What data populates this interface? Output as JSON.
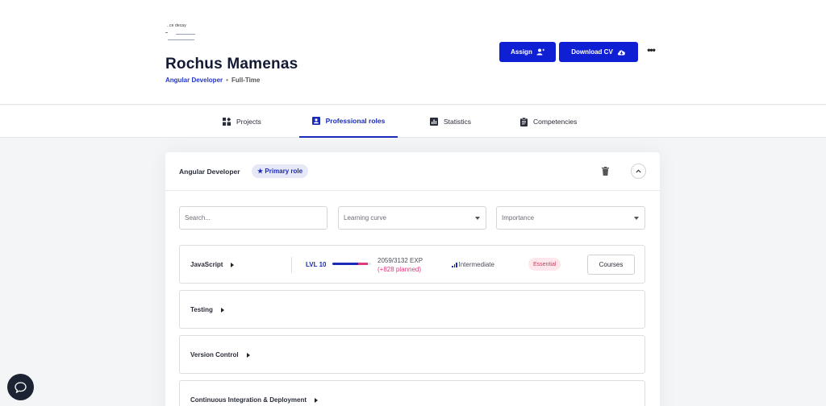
{
  "header": {
    "logo_text": "..ce decay",
    "name": "Rochus Mamenas",
    "role": "Angular Developer",
    "separator": "•",
    "employment": "Full-Time",
    "assign_label": "Assign",
    "download_label": "Download CV",
    "more_label": "•••"
  },
  "tabs": [
    {
      "label": "Projects",
      "icon": "dashboard-icon"
    },
    {
      "label": "Professional roles",
      "icon": "badge-icon",
      "active": true
    },
    {
      "label": "Statistics",
      "icon": "bar-chart-icon"
    },
    {
      "label": "Competencies",
      "icon": "clipboard-icon"
    }
  ],
  "role_card": {
    "title": "Angular Developer",
    "badge": "★ Primary role",
    "filters": {
      "search_placeholder": "Search...",
      "learning_curve": "Learning curve",
      "importance": "Importance"
    },
    "competencies": [
      {
        "name": "JavaScript",
        "level": "LVL 10",
        "exp": "2059/3132 EXP",
        "planned": "(+828 planned)",
        "progress_fraction": 0.657,
        "planned_fraction": 0.264,
        "proficiency": "Intermediate",
        "importance": "Essential",
        "courses_label": "Courses"
      },
      {
        "name": "Testing"
      },
      {
        "name": "Version Control"
      },
      {
        "name": "Continuous Integration & Deployment"
      }
    ]
  },
  "colors": {
    "accent": "#0f1fd4",
    "planned": "#e0397f",
    "essential_bg": "#fde7ec"
  }
}
